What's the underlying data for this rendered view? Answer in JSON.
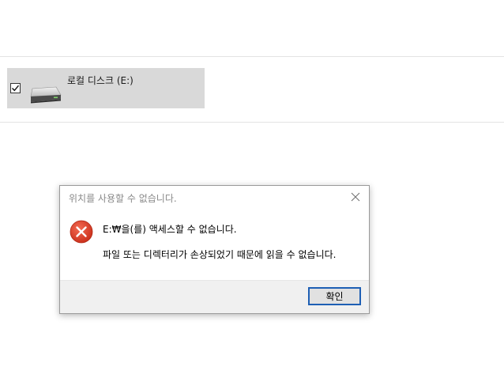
{
  "drive": {
    "label": "로컬 디스크 (E:)",
    "checked": true,
    "icon": "hard-drive-icon"
  },
  "dialog": {
    "title": "위치를 사용할 수 없습니다.",
    "icon": "error-icon",
    "message_primary": "E:₩을(를) 액세스할 수 없습니다.",
    "message_secondary": "파일 또는 디렉터리가 손상되었기 때문에 읽을 수 없습니다.",
    "ok_label": "확인",
    "close_icon": "close-icon"
  },
  "colors": {
    "error_red": "#e0412b",
    "button_border": "#1e5fb4",
    "tile_background": "#d9d9d9"
  }
}
